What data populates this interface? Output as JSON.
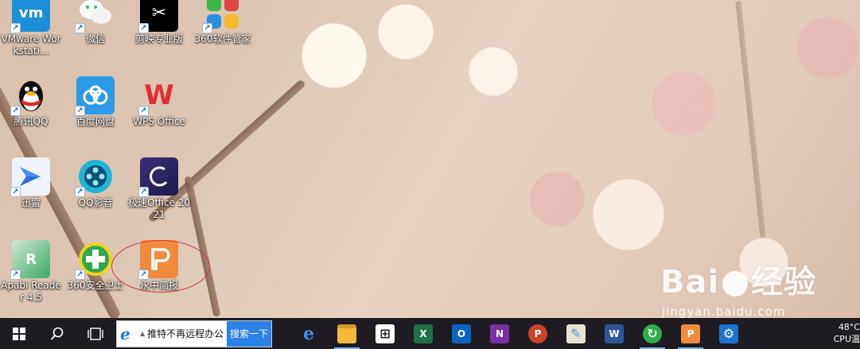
{
  "desktop_icons": [
    {
      "label": "VMware Workstati...",
      "icon": "vmware-icon",
      "color": "#1d8fd8"
    },
    {
      "label": "微信",
      "icon": "wechat-icon",
      "color": "#2bc15b"
    },
    {
      "label": "剪映专业版",
      "icon": "jianying-icon",
      "color": "#000000"
    },
    {
      "label": "360软件管家",
      "icon": "360-software-icon",
      "color": "#3bb54a"
    },
    {
      "label": "腾讯QQ",
      "icon": "qq-icon",
      "color": "#111111"
    },
    {
      "label": "百度网盘",
      "icon": "baidu-netdisk-icon",
      "color": "#2b9be8"
    },
    {
      "label": "WPS Office",
      "icon": "wps-icon",
      "color": "#e03030"
    },
    {
      "label": "迅雷",
      "icon": "thunder-icon",
      "color": "#4a8cf0"
    },
    {
      "label": "QQ影音",
      "icon": "qq-player-icon",
      "color": "#1fb5d6"
    },
    {
      "label": "极速Office 2021",
      "icon": "jisu-office-icon",
      "color": "#2d2a6a"
    },
    {
      "label": "Apabi Reader 4.5",
      "icon": "apabi-reader-icon",
      "color": "#2b9a5a"
    },
    {
      "label": "360安全卫士",
      "icon": "360-security-icon",
      "color": "#2fa84f"
    },
    {
      "label": "永中简报",
      "icon": "yozo-slides-icon",
      "color": "#f08a3c"
    }
  ],
  "taskbar": {
    "search_text": "推特不再远程办公",
    "search_button": "搜索一下",
    "apps": [
      {
        "name": "edge-icon",
        "glyph": "e",
        "color": "#1a73d1"
      },
      {
        "name": "file-explorer-icon",
        "glyph": "▬",
        "color": "#f2b93b"
      },
      {
        "name": "store-icon",
        "glyph": "⊞",
        "color": "#2a2a2a"
      },
      {
        "name": "excel-icon",
        "glyph": "X",
        "color": "#1e7145"
      },
      {
        "name": "outlook-icon",
        "glyph": "O",
        "color": "#0a64c2"
      },
      {
        "name": "onenote-icon",
        "glyph": "N",
        "color": "#7a2ea0"
      },
      {
        "name": "powerpoint-icon",
        "glyph": "P",
        "color": "#c8432a"
      },
      {
        "name": "paint-icon",
        "glyph": "✎",
        "color": "#5a8ed8"
      },
      {
        "name": "word-icon",
        "glyph": "W",
        "color": "#2b579a"
      },
      {
        "name": "update-icon",
        "glyph": "↻",
        "color": "#2fae4a"
      },
      {
        "name": "yozo-slides-taskbar-icon",
        "glyph": "P",
        "color": "#f08a3c"
      },
      {
        "name": "settings-icon",
        "glyph": "⚙",
        "color": "#1a73d1"
      }
    ],
    "tray_temp": "48°C",
    "tray_cpu": "CPU温"
  },
  "watermark": {
    "logo": "Bai  经验",
    "url": "jingyan.baidu.com"
  }
}
